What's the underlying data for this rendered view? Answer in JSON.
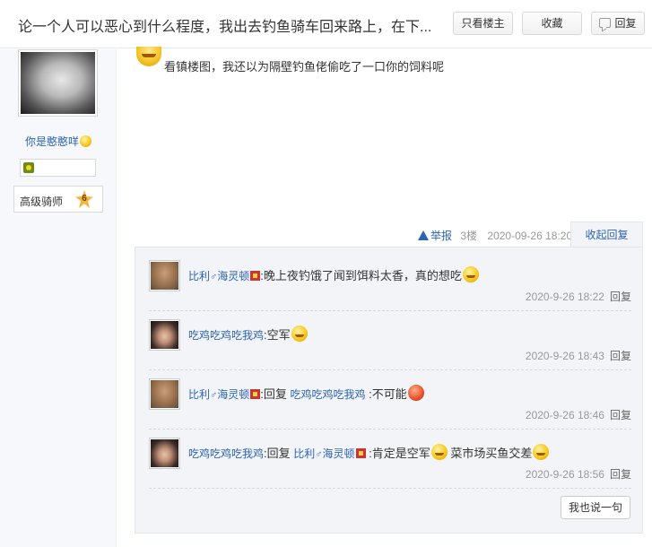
{
  "header": {
    "title": "论一个人可以恶心到什么程度，我出去钓鱼骑车回来路上，在下...",
    "only_author": "只看楼主",
    "favorite": "收藏",
    "reply": "回复"
  },
  "author": {
    "name": "你是憨憨咩",
    "level_name": "高级骑师",
    "level_num": "6"
  },
  "post": {
    "content": "看镇楼图，我还以为隔壁钓鱼佬偷吃了一口你的饲料呢",
    "report": "举报",
    "floor": "3楼",
    "time": "2020-09-26 18:20",
    "collapse": "收起回复"
  },
  "comments": [
    {
      "user": "比利",
      "gender": "♂",
      "user_suffix": "海灵顿",
      "text": ":晚上夜钓饿了闻到饵料太香，真的想吃",
      "time": "2020-9-26 18:22",
      "reply": "回复"
    },
    {
      "user": "吃鸡吃鸡吃我鸡",
      "text": ":空军",
      "time": "2020-9-26 18:43",
      "reply": "回复"
    },
    {
      "user": "比利",
      "gender": "♂",
      "user_suffix": "海灵顿",
      "reply_word": ":回复",
      "target": "吃鸡吃鸡吃我鸡",
      "text": ":不可能",
      "time": "2020-9-26 18:46",
      "reply": "回复"
    },
    {
      "user": "吃鸡吃鸡吃我鸡",
      "reply_word": ":回复",
      "target": "比利",
      "target_gender": "♂",
      "target_suffix": "海灵顿",
      "text": ":肯定是空军",
      "text2": "菜市场买鱼交差",
      "time": "2020-9-26 18:56",
      "reply": "回复"
    }
  ],
  "say_button": "我也说一句"
}
